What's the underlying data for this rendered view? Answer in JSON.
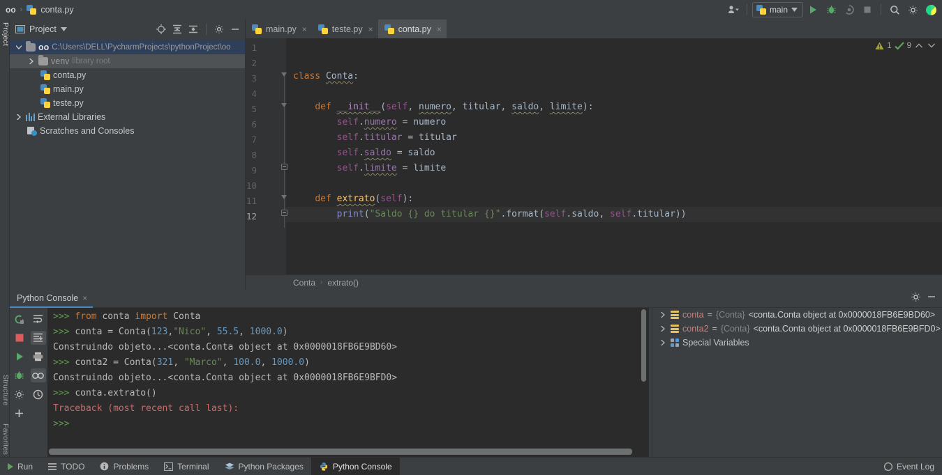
{
  "titlebar": {
    "project_name": "oo",
    "file_name": "conta.py",
    "separator": "›",
    "user_icon": "user-icon",
    "run_config": "main",
    "run_icon": "run-icon",
    "debug_icon": "debug-icon",
    "coverage_icon": "coverage-icon",
    "stop_icon": "stop-icon",
    "search_icon": "search-icon",
    "settings_icon": "settings-icon",
    "logo_icon": "pycharm-logo-icon"
  },
  "left_strip": {
    "project": "Project",
    "structure": "Structure",
    "favorites": "Favorites"
  },
  "project_panel": {
    "title": "Project",
    "collapse_all_icon": "collapse-all-icon",
    "expand_all_icon": "expand-all-icon",
    "locate_icon": "locate-icon",
    "settings_icon": "gear-icon",
    "hide_icon": "minimize-icon",
    "tree": [
      {
        "label": "oo",
        "path": "C:\\Users\\DELL\\PycharmProjects\\pythonProject\\oo",
        "type": "folder-root",
        "indent": 0,
        "expanded": true,
        "selected": "blue"
      },
      {
        "label": "venv",
        "sub": "library root",
        "type": "folder",
        "indent": 1,
        "expanded": false,
        "selected": "grey"
      },
      {
        "label": "conta.py",
        "type": "python",
        "indent": 2
      },
      {
        "label": "main.py",
        "type": "python",
        "indent": 2
      },
      {
        "label": "teste.py",
        "type": "python",
        "indent": 2
      },
      {
        "label": "External Libraries",
        "type": "library",
        "indent": 0,
        "expanded": false
      },
      {
        "label": "Scratches and Consoles",
        "type": "scratch",
        "indent": 0
      }
    ]
  },
  "editor": {
    "tabs": [
      {
        "label": "main.py",
        "active": false,
        "close": "×"
      },
      {
        "label": "teste.py",
        "active": false,
        "close": "×"
      },
      {
        "label": "conta.py",
        "active": true,
        "close": "×"
      }
    ],
    "inspections": {
      "warning_icon": "warning-triangle-icon",
      "warning_count": "1",
      "ok_icon": "inspection-ok-icon",
      "ok_count": "9",
      "prev_icon": "chevron-up-icon",
      "next_icon": "chevron-down-icon"
    },
    "line_numbers": [
      "1",
      "2",
      "3",
      "4",
      "5",
      "6",
      "7",
      "8",
      "9",
      "10",
      "11",
      "12"
    ],
    "code_lines": [
      {
        "n": 1,
        "tokens": []
      },
      {
        "n": 2,
        "tokens": []
      },
      {
        "n": 3,
        "tokens": [
          {
            "t": "class ",
            "c": "k"
          },
          {
            "t": "Conta",
            "c": "cls warn-sq"
          },
          {
            "t": ":",
            "c": "pn"
          }
        ]
      },
      {
        "n": 4,
        "tokens": []
      },
      {
        "n": 5,
        "tokens": [
          {
            "t": "    ",
            "c": "pn"
          },
          {
            "t": "def ",
            "c": "k"
          },
          {
            "t": "__init__",
            "c": "mg warn-sq"
          },
          {
            "t": "(",
            "c": "pn"
          },
          {
            "t": "self",
            "c": "sf"
          },
          {
            "t": ", ",
            "c": "pn"
          },
          {
            "t": "numero",
            "c": "pn warn-sq"
          },
          {
            "t": ", ",
            "c": "pn"
          },
          {
            "t": "titular",
            "c": "pn"
          },
          {
            "t": ", ",
            "c": "pn"
          },
          {
            "t": "saldo",
            "c": "pn warn-sq"
          },
          {
            "t": ", ",
            "c": "pn"
          },
          {
            "t": "limite",
            "c": "pn warn-sq"
          },
          {
            "t": "):",
            "c": "pn"
          }
        ]
      },
      {
        "n": 6,
        "tokens": [
          {
            "t": "        ",
            "c": "pn"
          },
          {
            "t": "self",
            "c": "sf"
          },
          {
            "t": ".",
            "c": "pn"
          },
          {
            "t": "numero",
            "c": "at warn-sq"
          },
          {
            "t": " = numero",
            "c": "pn"
          }
        ]
      },
      {
        "n": 7,
        "tokens": [
          {
            "t": "        ",
            "c": "pn"
          },
          {
            "t": "self",
            "c": "sf"
          },
          {
            "t": ".",
            "c": "pn"
          },
          {
            "t": "titular",
            "c": "at"
          },
          {
            "t": " = titular",
            "c": "pn"
          }
        ]
      },
      {
        "n": 8,
        "tokens": [
          {
            "t": "        ",
            "c": "pn"
          },
          {
            "t": "self",
            "c": "sf"
          },
          {
            "t": ".",
            "c": "pn"
          },
          {
            "t": "saldo",
            "c": "at warn-sq"
          },
          {
            "t": " = saldo",
            "c": "pn"
          }
        ]
      },
      {
        "n": 9,
        "tokens": [
          {
            "t": "        ",
            "c": "pn"
          },
          {
            "t": "self",
            "c": "sf"
          },
          {
            "t": ".",
            "c": "pn"
          },
          {
            "t": "limite",
            "c": "at warn-sq"
          },
          {
            "t": " = limite",
            "c": "pn"
          }
        ]
      },
      {
        "n": 10,
        "tokens": []
      },
      {
        "n": 11,
        "tokens": [
          {
            "t": "    ",
            "c": "pn"
          },
          {
            "t": "def ",
            "c": "k"
          },
          {
            "t": "extrato",
            "c": "fn warn-sq"
          },
          {
            "t": "(",
            "c": "pn"
          },
          {
            "t": "self",
            "c": "sf"
          },
          {
            "t": "):",
            "c": "pn"
          }
        ]
      },
      {
        "n": 12,
        "tokens": [
          {
            "t": "        ",
            "c": "pn"
          },
          {
            "t": "print",
            "c": "bi"
          },
          {
            "t": "(",
            "c": "pn"
          },
          {
            "t": "\"Saldo {} do titular {}\"",
            "c": "st"
          },
          {
            "t": ".",
            "c": "pn"
          },
          {
            "t": "format",
            "c": "pn"
          },
          {
            "t": "(",
            "c": "pn"
          },
          {
            "t": "self",
            "c": "sf"
          },
          {
            "t": ".saldo, ",
            "c": "pn"
          },
          {
            "t": "self",
            "c": "sf"
          },
          {
            "t": ".titular))",
            "c": "pn"
          }
        ]
      }
    ],
    "current_line": 12,
    "breadcrumb": [
      "Conta",
      "extrato()"
    ],
    "breadcrumb_sep": "›"
  },
  "console": {
    "tab_label": "Python Console",
    "tab_close": "×",
    "settings_icon": "gear-icon",
    "hide_icon": "minimize-icon",
    "gutter_left": [
      "rerun-icon",
      "stop-icon",
      "execute-icon",
      "debug-icon",
      "settings-icon",
      "add-icon"
    ],
    "gutter_right": [
      "soft-wrap-icon",
      "scroll-to-end-icon",
      "print-icon",
      "show-variables-icon",
      "history-icon"
    ],
    "output": [
      {
        "type": "prompt",
        "prompt": ">>>",
        "segments": [
          {
            "t": "from ",
            "c": "k"
          },
          {
            "t": "conta ",
            "c": "out"
          },
          {
            "t": "import ",
            "c": "k"
          },
          {
            "t": "Conta",
            "c": "out"
          }
        ]
      },
      {
        "type": "prompt",
        "prompt": ">>>",
        "segments": [
          {
            "t": "conta = Conta(",
            "c": "out"
          },
          {
            "t": "123",
            "c": "num"
          },
          {
            "t": ",",
            "c": "out"
          },
          {
            "t": "\"Nico\"",
            "c": "st"
          },
          {
            "t": ", ",
            "c": "out"
          },
          {
            "t": "55.5",
            "c": "num"
          },
          {
            "t": ", ",
            "c": "out"
          },
          {
            "t": "1000.0",
            "c": "num"
          },
          {
            "t": ")",
            "c": "out"
          }
        ]
      },
      {
        "type": "output",
        "segments": [
          {
            "t": "Construindo objeto...<conta.Conta object at 0x0000018FB6E9BD60>",
            "c": "out"
          }
        ]
      },
      {
        "type": "prompt",
        "prompt": ">>>",
        "segments": [
          {
            "t": "conta2 = Conta(",
            "c": "out"
          },
          {
            "t": "321",
            "c": "num"
          },
          {
            "t": ", ",
            "c": "out"
          },
          {
            "t": "\"Marco\"",
            "c": "st"
          },
          {
            "t": ", ",
            "c": "out"
          },
          {
            "t": "100.0",
            "c": "num"
          },
          {
            "t": ", ",
            "c": "out"
          },
          {
            "t": "1000.0",
            "c": "num"
          },
          {
            "t": ")",
            "c": "out"
          }
        ]
      },
      {
        "type": "output",
        "segments": [
          {
            "t": "Construindo objeto...<conta.Conta object at 0x0000018FB6E9BFD0>",
            "c": "out"
          }
        ]
      },
      {
        "type": "prompt",
        "prompt": ">>>",
        "segments": [
          {
            "t": "conta.extrato()",
            "c": "out"
          }
        ]
      },
      {
        "type": "error",
        "segments": [
          {
            "t": "Traceback (most recent call last):",
            "c": "red"
          }
        ]
      },
      {
        "type": "prompt",
        "prompt": ">>>",
        "segments": []
      }
    ],
    "variables": [
      {
        "name": "conta",
        "eq": "=",
        "type": "{Conta}",
        "value": "<conta.Conta object at 0x0000018FB6E9BD60>",
        "icon": "variable-icon",
        "expandable": true
      },
      {
        "name": "conta2",
        "eq": "=",
        "type": "{Conta}",
        "value": "<conta.Conta object at 0x0000018FB6E9BFD0>",
        "icon": "variable-icon",
        "expandable": true
      },
      {
        "name": "Special Variables",
        "icon": "special-variables-icon",
        "expandable": true,
        "plain": true
      }
    ]
  },
  "statusbar": {
    "items": [
      {
        "label": "Run",
        "icon": "run-icon",
        "active": false
      },
      {
        "label": "TODO",
        "icon": "todo-icon",
        "active": false
      },
      {
        "label": "Problems",
        "icon": "problems-icon",
        "active": false
      },
      {
        "label": "Terminal",
        "icon": "terminal-icon",
        "active": false
      },
      {
        "label": "Python Packages",
        "icon": "packages-icon",
        "active": false
      },
      {
        "label": "Python Console",
        "icon": "python-console-icon",
        "active": true
      }
    ],
    "event_log": "Event Log",
    "event_log_icon": "event-log-icon"
  },
  "colors": {
    "bg_panel": "#3c3f41",
    "bg_editor": "#2b2b2b",
    "accent_blue": "#4a88c7",
    "keyword": "#cc7832",
    "string": "#6a8759",
    "number": "#6897bb",
    "function": "#ffc66d",
    "self": "#94558d",
    "attribute": "#9876aa",
    "error_red": "#cf6a6a",
    "prompt_green": "#5f9e4f"
  }
}
